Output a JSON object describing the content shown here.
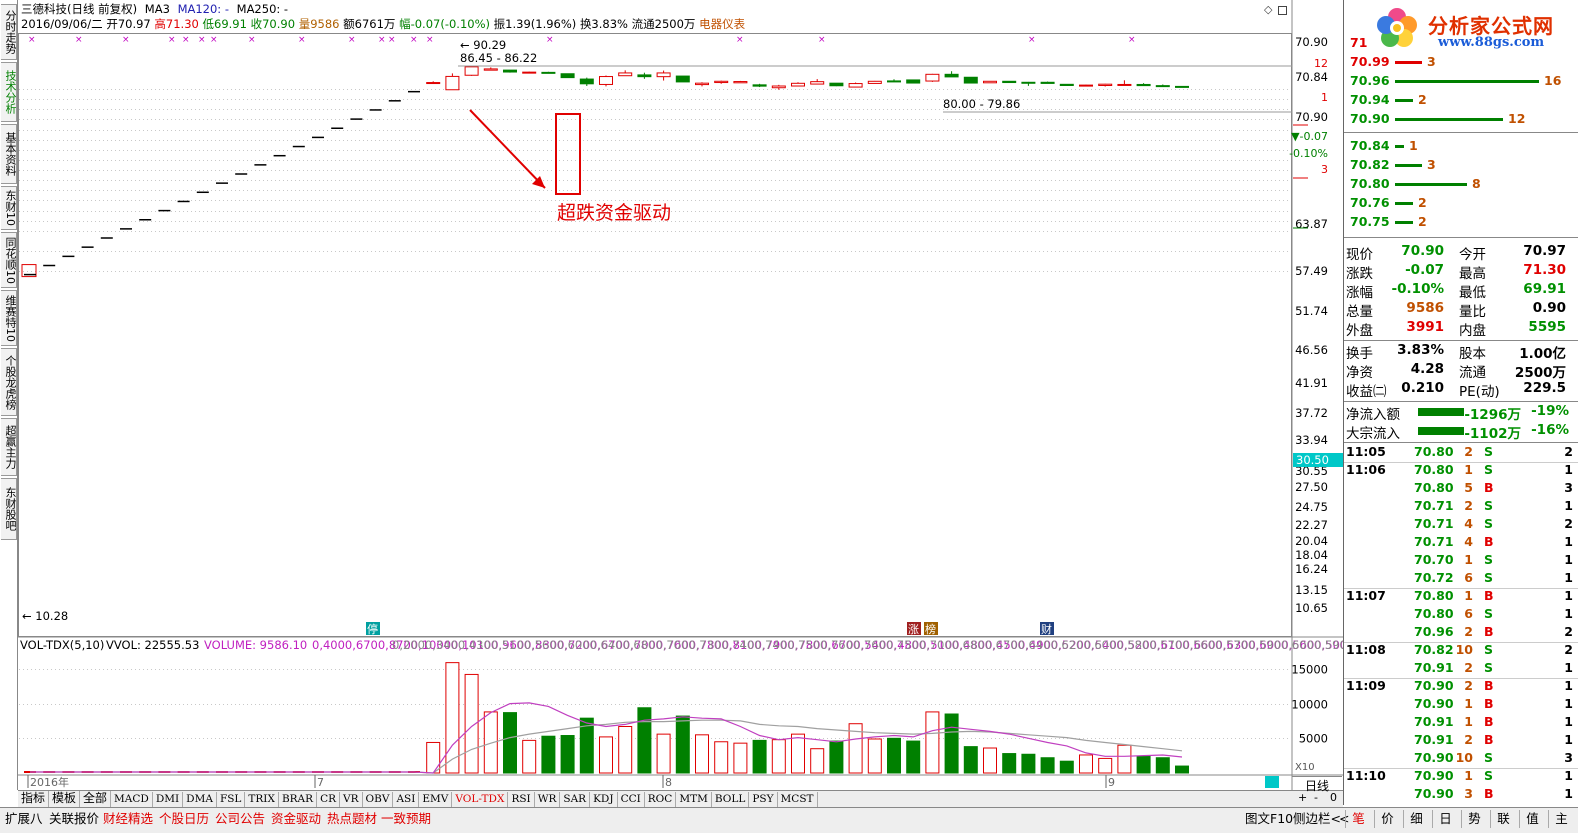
{
  "header": {
    "title": "三德科技(日线 前复权)",
    "ma3": "MA3",
    "ma120": "MA120: -",
    "ma250": "MA250: -",
    "date": "2016/09/06/二",
    "open": "开70.97",
    "high": "高71.30",
    "low": "低69.91",
    "close": "收70.90",
    "volume": "量9586",
    "amount": "额6761万",
    "change": "幅-0.07(-0.10%)",
    "amplitude": "振1.39(1.96%)",
    "turnover": "换3.83%",
    "float": "流通2500万",
    "sector": "电器仪表"
  },
  "left_tabs": [
    "分时走势",
    "技术分析",
    "基本资料",
    "东财10",
    "同花顺10",
    "维赛特10",
    "个股龙虎榜",
    "超赢主力",
    "东财股吧"
  ],
  "chart_data": {
    "type": "candlestick",
    "y_axis_labels": [
      "70.90",
      "70.84",
      "70.90",
      "63.87",
      "57.49",
      "51.74",
      "46.56",
      "41.91",
      "37.72",
      "33.94",
      "30.55",
      "27.50",
      "24.75",
      "22.27",
      "20.04",
      "18.04",
      "16.24",
      "13.15",
      "10.65"
    ],
    "axis_markers": {
      "top_small": "12",
      "mid_small": "1",
      "change_pct": "-0.10%",
      "change_val": "-0.07",
      "small3": "3",
      "current_box": "30.50"
    },
    "annotations": {
      "high_label": "90.29",
      "range1": "86.45 - 86.22",
      "range2": "80.00 - 79.86",
      "low_label": "10.28",
      "callout": "超跌资金驱动"
    },
    "event_markers": [
      "停",
      "涨",
      "榜",
      "财"
    ],
    "x_labels": [
      "2016年",
      "7",
      "8",
      "9"
    ],
    "ladder": [
      10.28,
      11.3,
      12.43,
      13.68,
      15.05,
      16.55,
      18.2,
      20.02,
      22.02,
      24.23,
      26.65,
      29.31,
      32.24,
      35.47,
      39.02,
      42.92,
      47.21,
      51.93,
      57.12,
      62.83,
      69.11
    ],
    "candles": [
      {
        "o": 76.0,
        "h": 77.0,
        "l": 76.0,
        "c": 76.0
      },
      {
        "o": 70.5,
        "h": 83.6,
        "l": 70.5,
        "c": 81.0
      },
      {
        "o": 82.0,
        "h": 90.29,
        "l": 81.5,
        "c": 89.5
      },
      {
        "o": 86.45,
        "h": 89.0,
        "l": 86.22,
        "c": 87.6
      },
      {
        "o": 86.5,
        "h": 86.5,
        "l": 84.3,
        "c": 84.8
      },
      {
        "o": 84.4,
        "h": 85.2,
        "l": 83.5,
        "c": 84.7
      },
      {
        "o": 84.5,
        "h": 85.0,
        "l": 83.7,
        "c": 84.0
      },
      {
        "o": 83.3,
        "h": 83.3,
        "l": 80.0,
        "c": 80.0
      },
      {
        "o": 78.8,
        "h": 80.0,
        "l": 73.3,
        "c": 75.0
      },
      {
        "o": 74.5,
        "h": 81.8,
        "l": 73.0,
        "c": 80.9
      },
      {
        "o": 81.6,
        "h": 86.3,
        "l": 81.6,
        "c": 84.0
      },
      {
        "o": 82.3,
        "h": 84.2,
        "l": 79.0,
        "c": 80.8
      },
      {
        "o": 80.8,
        "h": 86.1,
        "l": 77.6,
        "c": 84.0
      },
      {
        "o": 81.3,
        "h": 81.3,
        "l": 76.5,
        "c": 76.5
      },
      {
        "o": 74.4,
        "h": 76.2,
        "l": 73.0,
        "c": 75.5
      },
      {
        "o": 76.0,
        "h": 77.5,
        "l": 75.0,
        "c": 77.0
      },
      {
        "o": 75.8,
        "h": 77.3,
        "l": 75.8,
        "c": 76.8
      },
      {
        "o": 74.2,
        "h": 75.0,
        "l": 72.5,
        "c": 73.2
      },
      {
        "o": 72.0,
        "h": 74.2,
        "l": 70.5,
        "c": 73.3
      },
      {
        "o": 73.3,
        "h": 76.2,
        "l": 73.1,
        "c": 75.4
      },
      {
        "o": 74.8,
        "h": 78.8,
        "l": 74.5,
        "c": 76.7
      },
      {
        "o": 75.5,
        "h": 75.5,
        "l": 73.2,
        "c": 73.5
      },
      {
        "o": 72.5,
        "h": 76.0,
        "l": 72.5,
        "c": 75.2
      },
      {
        "o": 75.3,
        "h": 77.3,
        "l": 75.3,
        "c": 77.0
      },
      {
        "o": 77.3,
        "h": 78.6,
        "l": 76.5,
        "c": 76.8
      },
      {
        "o": 78.1,
        "h": 78.1,
        "l": 75.6,
        "c": 75.6
      },
      {
        "o": 77.2,
        "h": 83.2,
        "l": 76.5,
        "c": 82.8
      },
      {
        "o": 82.8,
        "h": 85.5,
        "l": 80.6,
        "c": 80.6
      },
      {
        "o": 80.3,
        "h": 80.3,
        "l": 75.5,
        "c": 75.6
      },
      {
        "o": 75.8,
        "h": 77.2,
        "l": 75.8,
        "c": 77.0
      },
      {
        "o": 77.0,
        "h": 77.0,
        "l": 75.8,
        "c": 76.0
      },
      {
        "o": 76.2,
        "h": 76.5,
        "l": 73.4,
        "c": 75.8
      },
      {
        "o": 76.2,
        "h": 76.8,
        "l": 75.3,
        "c": 75.3
      },
      {
        "o": 74.6,
        "h": 74.6,
        "l": 73.7,
        "c": 73.7
      },
      {
        "o": 73.7,
        "h": 74.4,
        "l": 73.5,
        "c": 74.0
      },
      {
        "o": 73.7,
        "h": 75.0,
        "l": 72.9,
        "c": 74.7
      },
      {
        "o": 74.5,
        "h": 77.8,
        "l": 74.4,
        "c": 74.5
      },
      {
        "o": 74.5,
        "h": 75.5,
        "l": 73.5,
        "c": 73.6
      },
      {
        "o": 73.6,
        "h": 74.5,
        "l": 73.0,
        "c": 73.2
      },
      {
        "o": 73.0,
        "h": 73.0,
        "l": 72.6,
        "c": 72.8
      }
    ],
    "volume": {
      "label": "VOL-TDX(5,10)",
      "vvol": "VVOL: 22555.53",
      "volume": "VOLUME: 9586.10",
      "ma5": [
        0,
        4000,
        6700,
        8700,
        10000,
        10100,
        9600,
        8300,
        7200,
        6700,
        7000,
        7600,
        7800,
        8100,
        7900,
        7800,
        6700,
        5400,
        4800,
        5100,
        4800,
        4500,
        4900,
        5200,
        5400,
        5200,
        6100,
        6600,
        6300,
        6000,
        5600,
        5000,
        4400,
        3900,
        2900,
        2400,
        2400,
        2500,
        2600,
        2300
      ],
      "ma10": [
        0,
        2000,
        3400,
        4300,
        5100,
        5600,
        6000,
        6400,
        6800,
        7000,
        7300,
        7400,
        7400,
        7500,
        7600,
        7600,
        7500,
        7000,
        6800,
        6700,
        6400,
        6200,
        6000,
        5800,
        5700,
        5600,
        5700,
        5900,
        6000,
        5900,
        5700,
        5500,
        5300,
        5100,
        4700,
        4400,
        4100,
        3800,
        3500,
        3200
      ],
      "ylabels": [
        "15000",
        "10000",
        "5000"
      ],
      "x10": "X10",
      "bars": [
        4400,
        15900,
        14200,
        8800,
        8700,
        4700,
        5300,
        5400,
        7900,
        5200,
        6700,
        9400,
        5600,
        8200,
        5500,
        4500,
        4300,
        4700,
        4800,
        5600,
        3500,
        4600,
        7100,
        4900,
        5000,
        4600,
        8800,
        8500,
        3800,
        3600,
        2800,
        2700,
        2200,
        1700,
        2600,
        2100,
        4000,
        2400,
        2200,
        1000
      ]
    }
  },
  "indicator_tabs": [
    "指标",
    "模板",
    "全部",
    "MACD",
    "DMI",
    "DMA",
    "FSL",
    "TRIX",
    "BRAR",
    "CR",
    "VR",
    "OBV",
    "ASI",
    "EMV",
    "VOL-TDX",
    "RSI",
    "WR",
    "SAR",
    "KDJ",
    "CCI",
    "ROC",
    "MTM",
    "BOLL",
    "PSY",
    "MCST"
  ],
  "period_label": "日线",
  "zoom_in": "+",
  "zoom_out": "-",
  "zoom_zero": "0",
  "func_tabs": [
    "扩展八",
    "关联报价",
    "财经精选",
    "个股日历",
    "公司公告",
    "资金驱动",
    "热点题材",
    "一致预期"
  ],
  "func_right": [
    "图文F10",
    "侧边栏<",
    "<"
  ],
  "right_bottom_tabs": [
    "笔",
    "价",
    "细",
    "日",
    "势",
    "联",
    "值",
    "主"
  ],
  "logo": {
    "title": "分析家公式网",
    "url": "www.88gs.com"
  },
  "sell_book": [
    {
      "price": "71.00",
      "vol": "",
      "bar": 0
    },
    {
      "price": "70.99",
      "vol": "3",
      "bar": 3
    },
    {
      "price": "70.96",
      "vol": "16",
      "bar": 16
    },
    {
      "price": "70.94",
      "vol": "2",
      "bar": 2
    },
    {
      "price": "70.90",
      "vol": "12",
      "bar": 12
    }
  ],
  "buy_book": [
    {
      "price": "70.84",
      "vol": "1",
      "bar": 1
    },
    {
      "price": "70.82",
      "vol": "3",
      "bar": 3
    },
    {
      "price": "70.80",
      "vol": "8",
      "bar": 8
    },
    {
      "price": "70.76",
      "vol": "2",
      "bar": 2
    },
    {
      "price": "70.75",
      "vol": "2",
      "bar": 2
    }
  ],
  "quote": {
    "xianjia_label": "现价",
    "xianjia": "70.90",
    "jinkai_label": "今开",
    "jinkai": "70.97",
    "zhangdie_label": "涨跌",
    "zhangdie": "-0.07",
    "zuigao_label": "最高",
    "zuigao": "71.30",
    "zhangfu_label": "涨幅",
    "zhangfu": "-0.10%",
    "zuidi_label": "最低",
    "zuidi": "69.91",
    "zongliang_label": "总量",
    "zongliang": "9586",
    "liangbi_label": "量比",
    "liangbi": "0.90",
    "waipan_label": "外盘",
    "waipan": "3991",
    "neipan_label": "内盘",
    "neipan": "5595",
    "huanshou_label": "换手",
    "huanshou": "3.83%",
    "guben_label": "股本",
    "guben": "1.00亿",
    "jingzi_label": "净资",
    "jingzi": "4.28",
    "liutong_label": "流通",
    "liutong": "2500万",
    "shouyi_label": "收益㈡",
    "shouyi": "0.210",
    "pe_label": "PE(动)",
    "pe": "229.5",
    "jingliuru_label": "净流入额",
    "jingliuru": "-1296万",
    "jingliuru_pct": "-19%",
    "dazong_label": "大宗流入",
    "dazong": "-1102万",
    "dazong_pct": "-16%"
  },
  "trades": [
    {
      "time": "11:05",
      "price": "70.80",
      "vol": "2",
      "bs": "S",
      "n": "2"
    },
    {
      "time": "11:06",
      "price": "70.80",
      "vol": "1",
      "bs": "S",
      "n": "1"
    },
    {
      "time": "",
      "price": "70.80",
      "vol": "5",
      "bs": "B",
      "n": "3"
    },
    {
      "time": "",
      "price": "70.71",
      "vol": "2",
      "bs": "S",
      "n": "1"
    },
    {
      "time": "",
      "price": "70.71",
      "vol": "4",
      "bs": "S",
      "n": "2"
    },
    {
      "time": "",
      "price": "70.71",
      "vol": "4",
      "bs": "B",
      "n": "1"
    },
    {
      "time": "",
      "price": "70.70",
      "vol": "1",
      "bs": "S",
      "n": "1"
    },
    {
      "time": "",
      "price": "70.72",
      "vol": "6",
      "bs": "S",
      "n": "1"
    },
    {
      "time": "11:07",
      "price": "70.80",
      "vol": "1",
      "bs": "B",
      "n": "1"
    },
    {
      "time": "",
      "price": "70.80",
      "vol": "6",
      "bs": "S",
      "n": "1"
    },
    {
      "time": "",
      "price": "70.96",
      "vol": "2",
      "bs": "B",
      "n": "2"
    },
    {
      "time": "11:08",
      "price": "70.82",
      "vol": "10",
      "bs": "S",
      "n": "2"
    },
    {
      "time": "",
      "price": "70.91",
      "vol": "2",
      "bs": "S",
      "n": "1"
    },
    {
      "time": "11:09",
      "price": "70.90",
      "vol": "2",
      "bs": "B",
      "n": "1"
    },
    {
      "time": "",
      "price": "70.90",
      "vol": "1",
      "bs": "B",
      "n": "1"
    },
    {
      "time": "",
      "price": "70.91",
      "vol": "1",
      "bs": "B",
      "n": "1"
    },
    {
      "time": "",
      "price": "70.91",
      "vol": "2",
      "bs": "B",
      "n": "1"
    },
    {
      "time": "",
      "price": "70.90",
      "vol": "10",
      "bs": "S",
      "n": "3"
    },
    {
      "time": "11:10",
      "price": "70.90",
      "vol": "1",
      "bs": "S",
      "n": "1"
    },
    {
      "time": "",
      "price": "70.90",
      "vol": "3",
      "bs": "B",
      "n": "1"
    }
  ],
  "colors": {
    "up": "#e00000",
    "down": "#008000",
    "label_green": "#009000",
    "accent_red": "#ff0000",
    "ma5": "#c040c0",
    "ma10": "#a0a0a0",
    "blue": "#1010c0"
  }
}
